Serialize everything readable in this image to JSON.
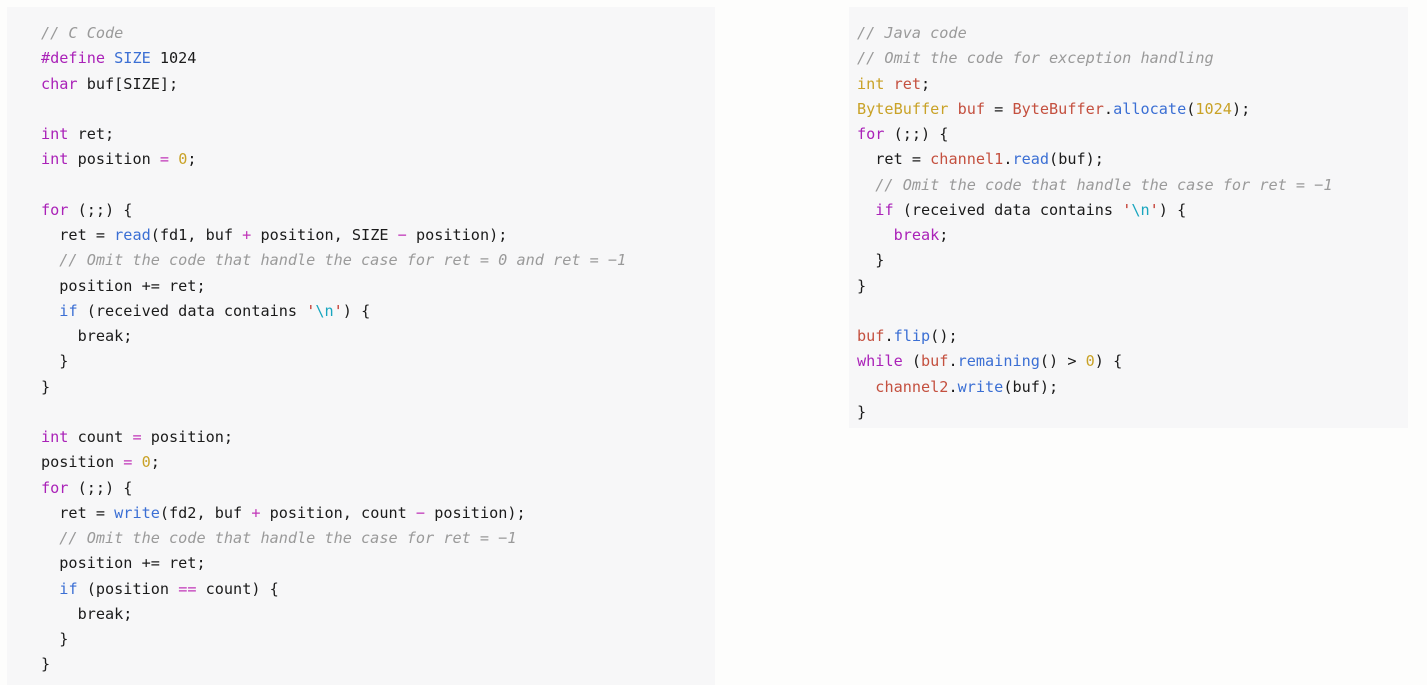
{
  "page": {
    "background_color": "#fdfdfc",
    "panel_background_color": "#f7f7f8",
    "title": "C vs Java blocking I/O code comparison"
  },
  "palette": {
    "plain": "#1b1b1b",
    "comment": "#9a9a9a",
    "keyword_magenta": "#aa22b8",
    "keyword_blue": "#3b6fd4",
    "function_blue": "#3b6fd4",
    "operator_magenta": "#c035b8",
    "number_gold": "#c9a227",
    "string_red": "#c2352b",
    "escape_cyan": "#19a6bf",
    "java_type_gold": "#c9a227",
    "java_ident_red": "#c4503f"
  },
  "panels": [
    {
      "id": "c-code-panel",
      "language": "C",
      "header_comment": "// C Code",
      "plain_text": "// C Code\n#define SIZE 1024\nchar buf[SIZE];\n\nint ret;\nint position = 0;\n\nfor (;;) {\n  ret = read(fd1, buf + position, SIZE - position);\n  // Omit the code that handle the case for ret = 0 and ret = -1\n  position += ret;\n  if (received data contains '\\n') {\n    break;\n  }\n}\n\nint count = position;\nposition = 0;\nfor (;;) {\n  ret = write(fd2, buf + position, count - position);\n  // Omit the code that handle the case for ret = -1\n  position += ret;\n  if (position == count) {\n    break;\n  }\n}",
      "lines": [
        [
          {
            "t": "// C Code",
            "c": "comment"
          }
        ],
        [
          {
            "t": "#define ",
            "c": "keyword"
          },
          {
            "t": "SIZE",
            "c": "kw-blue"
          },
          {
            "t": " 1024",
            "c": "num-dark"
          }
        ],
        [
          {
            "t": "char",
            "c": "keyword"
          },
          {
            "t": " buf[SIZE];",
            "c": "plain"
          }
        ],
        [],
        [
          {
            "t": "int",
            "c": "keyword"
          },
          {
            "t": " ret;",
            "c": "plain"
          }
        ],
        [
          {
            "t": "int",
            "c": "keyword"
          },
          {
            "t": " position ",
            "c": "plain"
          },
          {
            "t": "=",
            "c": "op"
          },
          {
            "t": " ",
            "c": "plain"
          },
          {
            "t": "0",
            "c": "num"
          },
          {
            "t": ";",
            "c": "plain"
          }
        ],
        [],
        [
          {
            "t": "for",
            "c": "keyword"
          },
          {
            "t": " (;;) {",
            "c": "plain"
          }
        ],
        [
          {
            "t": "  ret = ",
            "c": "plain"
          },
          {
            "t": "read",
            "c": "func"
          },
          {
            "t": "(fd1, buf ",
            "c": "plain"
          },
          {
            "t": "+",
            "c": "op"
          },
          {
            "t": " position, SIZE ",
            "c": "plain"
          },
          {
            "t": "−",
            "c": "op"
          },
          {
            "t": " position);",
            "c": "plain"
          }
        ],
        [
          {
            "t": "  // Omit the code that handle the case for ret = 0 and ret = −1",
            "c": "comment"
          }
        ],
        [
          {
            "t": "  position += ret;",
            "c": "plain"
          }
        ],
        [
          {
            "t": "  ",
            "c": "plain"
          },
          {
            "t": "if",
            "c": "kw-blue"
          },
          {
            "t": " (received data contains ",
            "c": "plain"
          },
          {
            "t": "'",
            "c": "str"
          },
          {
            "t": "\\n",
            "c": "esc"
          },
          {
            "t": "'",
            "c": "str"
          },
          {
            "t": ") {",
            "c": "plain"
          }
        ],
        [
          {
            "t": "    break;",
            "c": "plain"
          }
        ],
        [
          {
            "t": "  }",
            "c": "plain"
          }
        ],
        [
          {
            "t": "}",
            "c": "plain"
          }
        ],
        [],
        [
          {
            "t": "int",
            "c": "keyword"
          },
          {
            "t": " count ",
            "c": "plain"
          },
          {
            "t": "=",
            "c": "op"
          },
          {
            "t": " position;",
            "c": "plain"
          }
        ],
        [
          {
            "t": "position ",
            "c": "plain"
          },
          {
            "t": "=",
            "c": "op"
          },
          {
            "t": " ",
            "c": "plain"
          },
          {
            "t": "0",
            "c": "num"
          },
          {
            "t": ";",
            "c": "plain"
          }
        ],
        [
          {
            "t": "for",
            "c": "keyword"
          },
          {
            "t": " (;;) {",
            "c": "plain"
          }
        ],
        [
          {
            "t": "  ret = ",
            "c": "plain"
          },
          {
            "t": "write",
            "c": "func"
          },
          {
            "t": "(fd2, buf ",
            "c": "plain"
          },
          {
            "t": "+",
            "c": "op"
          },
          {
            "t": " position, count ",
            "c": "plain"
          },
          {
            "t": "−",
            "c": "op"
          },
          {
            "t": " position);",
            "c": "plain"
          }
        ],
        [
          {
            "t": "  // Omit the code that handle the case for ret = −1",
            "c": "comment"
          }
        ],
        [
          {
            "t": "  position += ret;",
            "c": "plain"
          }
        ],
        [
          {
            "t": "  ",
            "c": "plain"
          },
          {
            "t": "if",
            "c": "kw-blue"
          },
          {
            "t": " (position ",
            "c": "plain"
          },
          {
            "t": "==",
            "c": "op"
          },
          {
            "t": " count) {",
            "c": "plain"
          }
        ],
        [
          {
            "t": "    break;",
            "c": "plain"
          }
        ],
        [
          {
            "t": "  }",
            "c": "plain"
          }
        ],
        [
          {
            "t": "}",
            "c": "plain"
          }
        ]
      ]
    },
    {
      "id": "java-code-panel",
      "language": "Java",
      "header_comment": "// Java code",
      "plain_text": "// Java code\n// Omit the code for exception handling\nint ret;\nByteBuffer buf = ByteBuffer.allocate(1024);\nfor (;;) {\n  ret = channel1.read(buf);\n  // Omit the code that handle the case for ret = -1\n  if (received data contains '\\n') {\n    break;\n  }\n}\n\nbuf.flip();\nwhile (buf.remaining() > 0) {\n  channel2.write(buf);\n}",
      "lines": [
        [
          {
            "t": "// Java code",
            "c": "comment"
          }
        ],
        [
          {
            "t": "// Omit the code for exception handling",
            "c": "comment"
          }
        ],
        [
          {
            "t": "int",
            "c": "jtype"
          },
          {
            "t": " ",
            "c": "plain"
          },
          {
            "t": "ret",
            "c": "jident"
          },
          {
            "t": ";",
            "c": "plain"
          }
        ],
        [
          {
            "t": "ByteBuffer",
            "c": "jtype"
          },
          {
            "t": " ",
            "c": "plain"
          },
          {
            "t": "buf",
            "c": "jident"
          },
          {
            "t": " = ",
            "c": "plain"
          },
          {
            "t": "ByteBuffer",
            "c": "jident"
          },
          {
            "t": ".",
            "c": "plain"
          },
          {
            "t": "allocate",
            "c": "jfunc"
          },
          {
            "t": "(",
            "c": "plain"
          },
          {
            "t": "1024",
            "c": "num"
          },
          {
            "t": ");",
            "c": "plain"
          }
        ],
        [
          {
            "t": "for",
            "c": "keyword"
          },
          {
            "t": " (;;) {",
            "c": "plain"
          }
        ],
        [
          {
            "t": "  ret = ",
            "c": "plain"
          },
          {
            "t": "channel1",
            "c": "jident"
          },
          {
            "t": ".",
            "c": "plain"
          },
          {
            "t": "read",
            "c": "jfunc"
          },
          {
            "t": "(buf);",
            "c": "plain"
          }
        ],
        [
          {
            "t": "  // Omit the code that handle the case for ret = −1",
            "c": "comment"
          }
        ],
        [
          {
            "t": "  ",
            "c": "plain"
          },
          {
            "t": "if",
            "c": "keyword"
          },
          {
            "t": " (received data contains ",
            "c": "plain"
          },
          {
            "t": "'",
            "c": "str"
          },
          {
            "t": "\\n",
            "c": "esc"
          },
          {
            "t": "'",
            "c": "str"
          },
          {
            "t": ") {",
            "c": "plain"
          }
        ],
        [
          {
            "t": "    ",
            "c": "plain"
          },
          {
            "t": "break",
            "c": "keyword"
          },
          {
            "t": ";",
            "c": "plain"
          }
        ],
        [
          {
            "t": "  }",
            "c": "plain"
          }
        ],
        [
          {
            "t": "}",
            "c": "plain"
          }
        ],
        [],
        [
          {
            "t": "buf",
            "c": "jident"
          },
          {
            "t": ".",
            "c": "plain"
          },
          {
            "t": "flip",
            "c": "jfunc"
          },
          {
            "t": "();",
            "c": "plain"
          }
        ],
        [
          {
            "t": "while",
            "c": "keyword"
          },
          {
            "t": " (",
            "c": "plain"
          },
          {
            "t": "buf",
            "c": "jident"
          },
          {
            "t": ".",
            "c": "plain"
          },
          {
            "t": "remaining",
            "c": "jfunc"
          },
          {
            "t": "() > ",
            "c": "plain"
          },
          {
            "t": "0",
            "c": "num"
          },
          {
            "t": ") {",
            "c": "plain"
          }
        ],
        [
          {
            "t": "  ",
            "c": "plain"
          },
          {
            "t": "channel2",
            "c": "jident"
          },
          {
            "t": ".",
            "c": "plain"
          },
          {
            "t": "write",
            "c": "jfunc"
          },
          {
            "t": "(buf);",
            "c": "plain"
          }
        ],
        [
          {
            "t": "}",
            "c": "plain"
          }
        ]
      ]
    }
  ]
}
